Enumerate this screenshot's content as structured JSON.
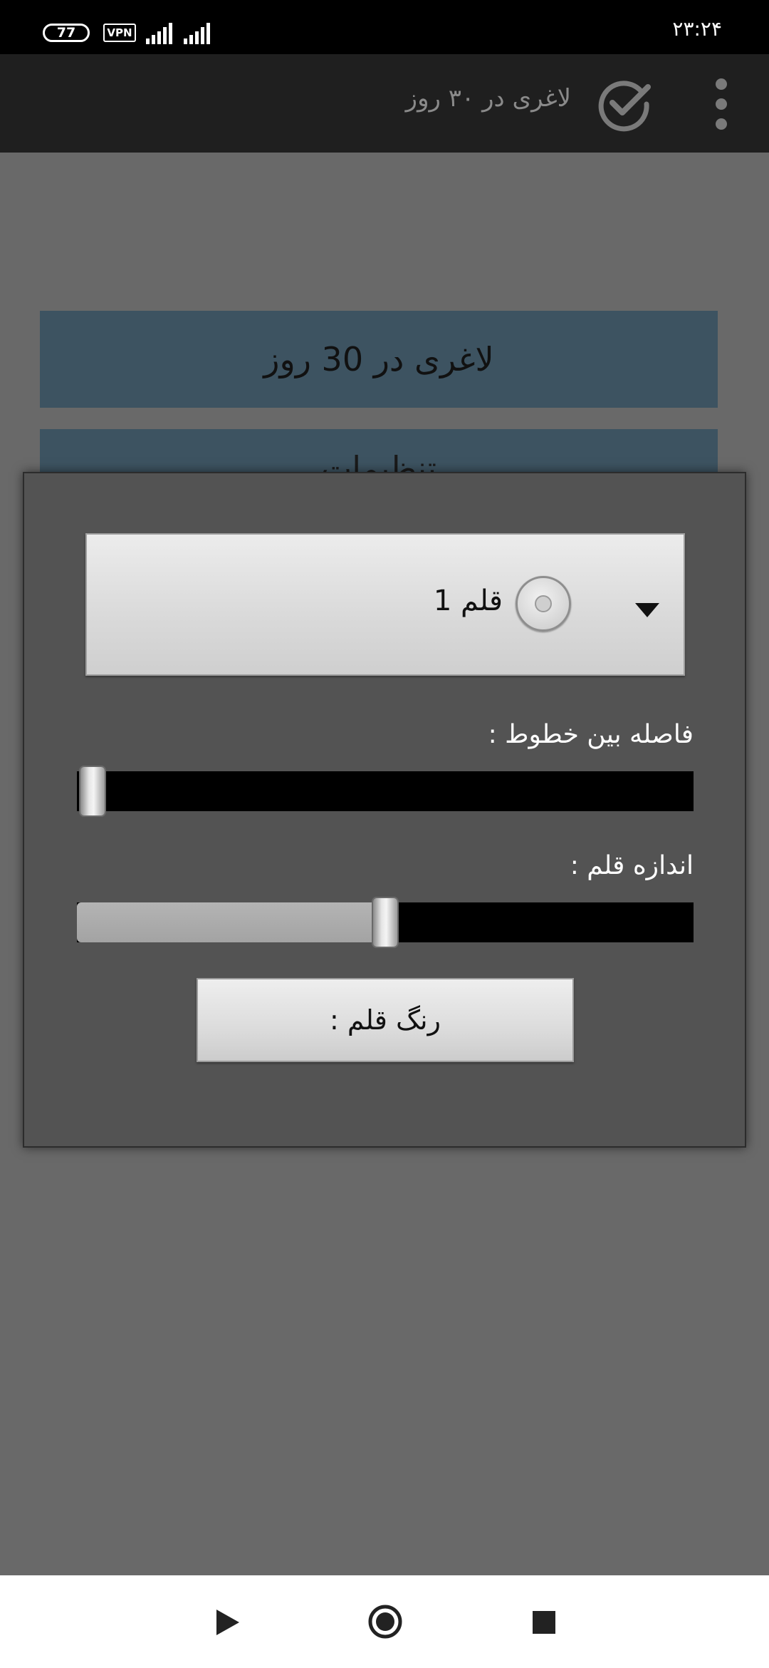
{
  "status_bar": {
    "battery": "77",
    "vpn": "VPN",
    "time": "۲۳:۲۴"
  },
  "app_bar": {
    "title": "لاغری در ۳۰ روز",
    "icons": [
      "check-circle-icon",
      "overflow-menu-icon"
    ]
  },
  "background_list": {
    "items": [
      {
        "label": "لاغری در 30 روز"
      },
      {
        "label": "تنظیمات"
      }
    ]
  },
  "dialog": {
    "font_selector": {
      "selected": "قلم 1"
    },
    "line_spacing": {
      "label": "فاصله بین خطوط :",
      "value_fraction": 0.0
    },
    "font_size": {
      "label": "اندازه قلم :",
      "value_fraction": 0.5
    },
    "font_color_button": {
      "label": "رنگ قلم :"
    }
  },
  "nav_bar": {
    "icons": [
      "back-icon",
      "home-icon",
      "recents-icon"
    ]
  },
  "colors": {
    "status_bar": "#000000",
    "app_bar": "#1f1f1f",
    "scrim": "#696969",
    "list_item": "#3d5361",
    "dialog": "#535353",
    "slider_track": "#000000",
    "slider_fill": "#aaaaaa"
  }
}
